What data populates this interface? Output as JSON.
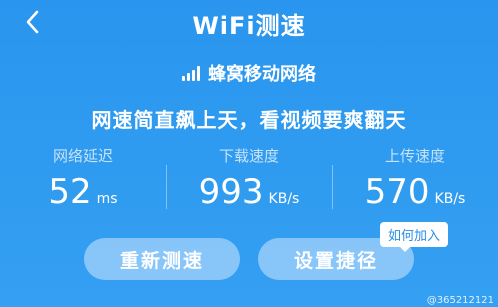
{
  "header": {
    "title": "WiFi测速"
  },
  "network": {
    "label": "蜂窝移动网络"
  },
  "slogan": "网速简直飙上天，看视频要爽翻天",
  "metrics": [
    {
      "label": "网络延迟",
      "value": "52",
      "unit": "ms"
    },
    {
      "label": "下载速度",
      "value": "993",
      "unit": "KB/s"
    },
    {
      "label": "上传速度",
      "value": "570",
      "unit": "KB/s"
    }
  ],
  "buttons": {
    "retest": "重新测速",
    "shortcut": "设置捷径"
  },
  "tooltip": "如何加入",
  "watermark": "@365212121"
}
